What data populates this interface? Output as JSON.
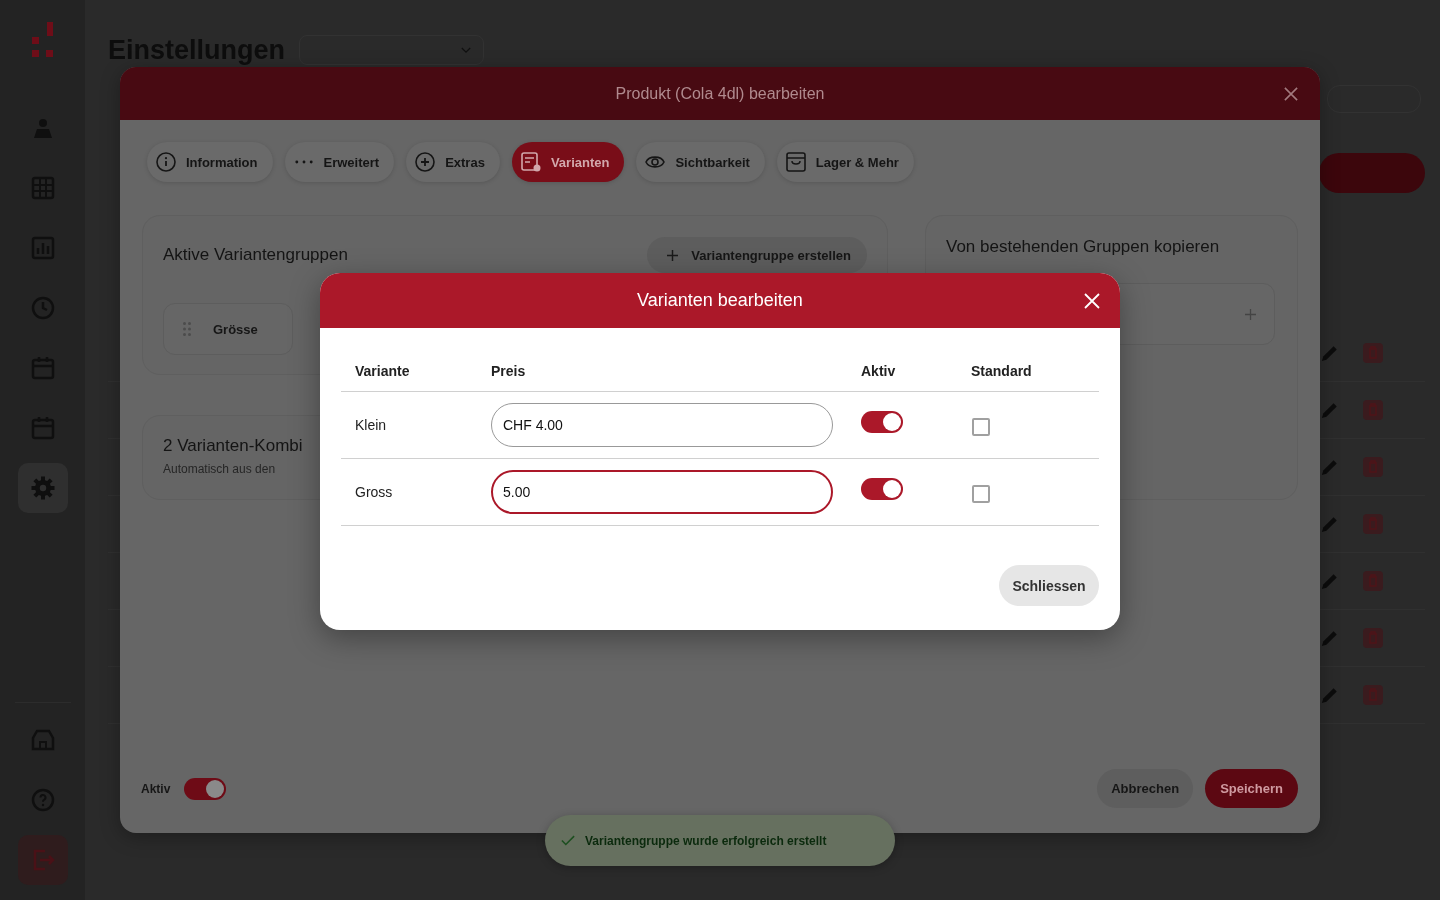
{
  "sidebar": {
    "items": [
      {
        "selected": false
      },
      {
        "selected": false
      },
      {
        "selected": false
      },
      {
        "selected": false
      },
      {
        "selected": false
      },
      {
        "selected": false
      },
      {
        "selected": true
      }
    ],
    "footer_items": [
      {
        "kind": "link"
      },
      {
        "kind": "link"
      },
      {
        "kind": "logout"
      }
    ]
  },
  "page": {
    "title": "Einstellungen"
  },
  "product_dialog": {
    "title": "Produkt (Cola 4dl) bearbeiten",
    "tabs": [
      {
        "label": "Information",
        "selected": false
      },
      {
        "label": "Erweitert",
        "selected": false
      },
      {
        "label": "Extras",
        "selected": false
      },
      {
        "label": "Varianten",
        "selected": true
      },
      {
        "label": "Sichtbarkeit",
        "selected": false
      },
      {
        "label": "Lager & Mehr",
        "selected": false
      }
    ],
    "active_groups": {
      "title": "Aktive Variantengruppen",
      "create_button": "Variantengruppe erstellen",
      "groups": [
        {
          "name": "Grösse"
        }
      ]
    },
    "combinations": {
      "title": "2 Varianten-Kombi",
      "subtitle": "Automatisch aus den"
    },
    "copy_groups": {
      "title": "Von bestehenden Gruppen kopieren"
    },
    "active": {
      "label": "Aktiv",
      "on": true
    },
    "buttons": {
      "cancel": "Abbrechen",
      "save": "Speichern"
    }
  },
  "toast": {
    "message": "Variantengruppe wurde erfolgreich erstellt"
  },
  "variant_dialog": {
    "title": "Varianten bearbeiten",
    "columns": [
      "Variante",
      "Preis",
      "Aktiv",
      "Standard"
    ],
    "rows": [
      {
        "name": "Klein",
        "price": "CHF 4.00",
        "focused": false,
        "active": true,
        "default": false
      },
      {
        "name": "Gross",
        "price": "5.00",
        "focused": true,
        "active": true,
        "default": false
      }
    ],
    "close_button": "Schliessen"
  }
}
